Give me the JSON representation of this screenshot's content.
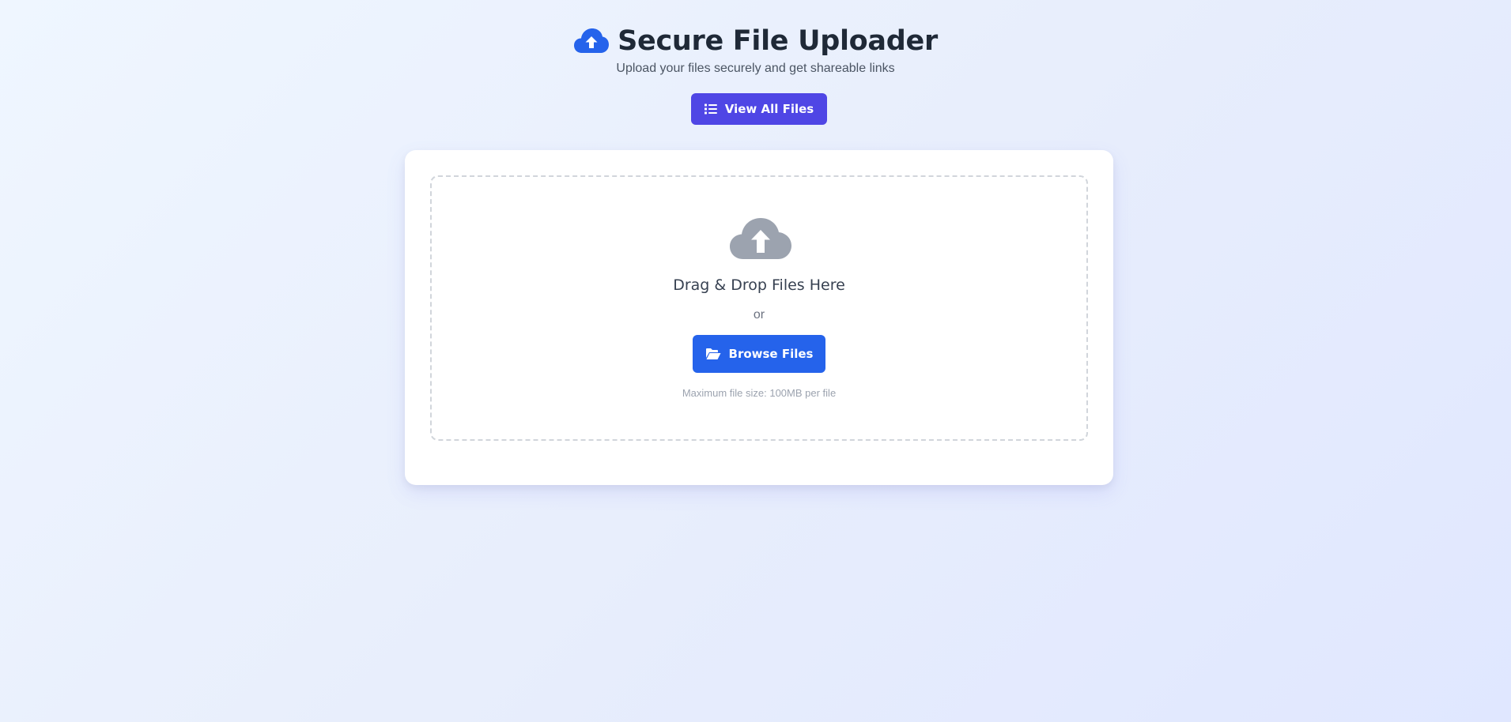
{
  "header": {
    "title": "Secure File Uploader",
    "subtitle": "Upload your files securely and get shareable links",
    "title_icon": "cloud-upload-icon"
  },
  "actions": {
    "view_all_label": "View All Files",
    "view_all_icon": "list-icon"
  },
  "dropzone": {
    "icon": "cloud-upload-icon",
    "heading": "Drag & Drop Files Here",
    "or_text": "or",
    "browse_label": "Browse Files",
    "browse_icon": "folder-open-icon",
    "hint": "Maximum file size: 100MB per file"
  },
  "colors": {
    "primary_blue": "#2563eb",
    "indigo": "#4f46e5",
    "muted_icon": "#9ca3af",
    "text_dark": "#1f2937"
  }
}
